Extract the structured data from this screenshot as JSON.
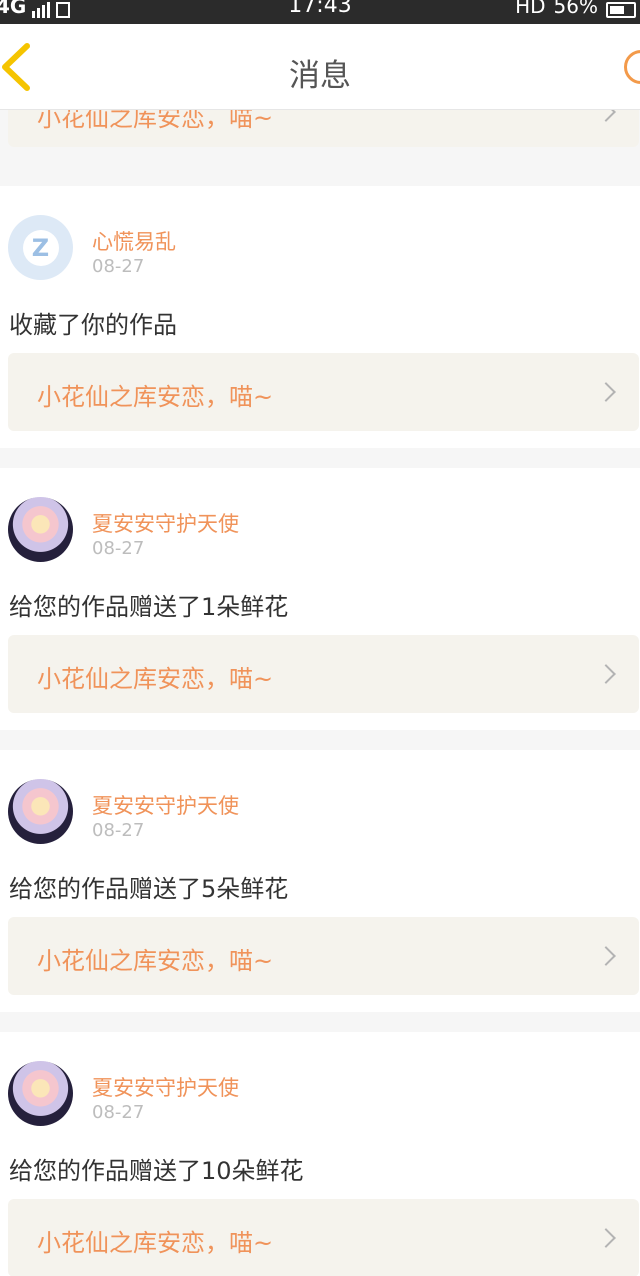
{
  "status_bar": {
    "network": "4G",
    "time": "17:43",
    "hd": "HD",
    "battery": "56%"
  },
  "nav": {
    "back_icon": "chevron-left-icon",
    "title": "消息",
    "right_icon": "circle-icon"
  },
  "partial_card": {
    "text": "小花仙之库安恋，喵~"
  },
  "messages": [
    {
      "avatar": "default-q-avatar",
      "name": "心慌易乱",
      "date": "08-27",
      "text": "收藏了你的作品",
      "card_text": "小花仙之库安恋，喵~"
    },
    {
      "avatar": "anime-avatar",
      "name": "夏安安守护天使",
      "date": "08-27",
      "text": "给您的作品赠送了1朵鲜花",
      "card_text": "小花仙之库安恋，喵~"
    },
    {
      "avatar": "anime-avatar",
      "name": "夏安安守护天使",
      "date": "08-27",
      "text": "给您的作品赠送了5朵鲜花",
      "card_text": "小花仙之库安恋，喵~"
    },
    {
      "avatar": "anime-avatar",
      "name": "夏安安守护天使",
      "date": "08-27",
      "text": "给您的作品赠送了10朵鲜花",
      "card_text": "小花仙之库安恋，喵~"
    }
  ],
  "colors": {
    "accent": "#f0935a",
    "back_icon": "#f5c400",
    "card_bg": "#f5f3ed"
  }
}
